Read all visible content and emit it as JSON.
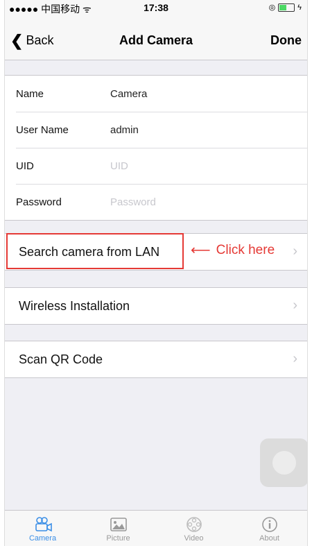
{
  "status_bar": {
    "carrier": "●●●●● 中国移动 ᯤ",
    "time": "17:38"
  },
  "nav": {
    "back_label": "Back",
    "title": "Add Camera",
    "done_label": "Done"
  },
  "form": {
    "fields": [
      {
        "label": "Name",
        "value": "Camera",
        "placeholder": ""
      },
      {
        "label": "User Name",
        "value": "admin",
        "placeholder": ""
      },
      {
        "label": "UID",
        "value": "",
        "placeholder": "UID"
      },
      {
        "label": "Password",
        "value": "",
        "placeholder": "Password"
      }
    ]
  },
  "actions": [
    {
      "label": "Search camera from LAN"
    },
    {
      "label": "Wireless Installation"
    },
    {
      "label": "Scan QR Code"
    }
  ],
  "annotation": {
    "text": "Click here",
    "color": "#e53935"
  },
  "tabs": [
    {
      "label": "Camera",
      "icon": "camera-icon",
      "active": true
    },
    {
      "label": "Picture",
      "icon": "picture-icon",
      "active": false
    },
    {
      "label": "Video",
      "icon": "video-icon",
      "active": false
    },
    {
      "label": "About",
      "icon": "info-icon",
      "active": false
    }
  ],
  "colors": {
    "accent": "#3a8ee6",
    "background": "#efeff4"
  }
}
